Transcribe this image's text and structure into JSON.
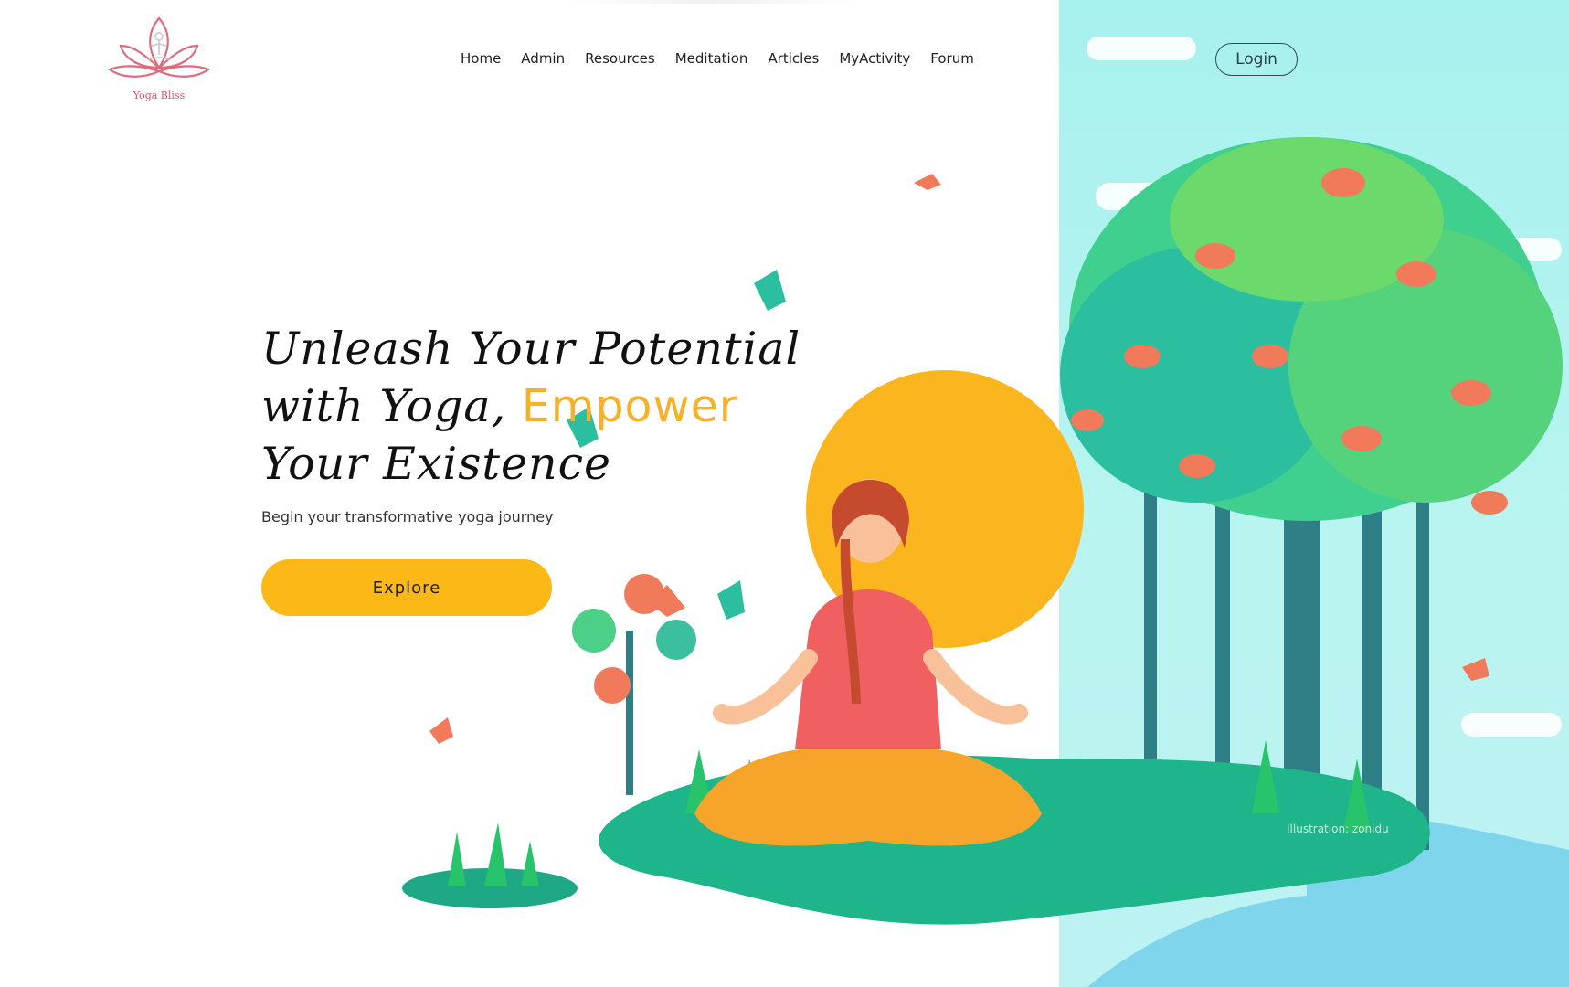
{
  "brand": {
    "name": "Yoga Bliss",
    "logo_icon": "lotus-meditation-icon",
    "color": "#d8556a"
  },
  "nav": {
    "items": [
      {
        "label": "Home"
      },
      {
        "label": "Admin"
      },
      {
        "label": "Resources"
      },
      {
        "label": "Meditation"
      },
      {
        "label": "Articles"
      },
      {
        "label": "MyActivity"
      },
      {
        "label": "Forum"
      }
    ],
    "login_label": "Login"
  },
  "hero": {
    "title_part1": "Unleash Your Potential with Yoga, ",
    "title_accent": "Empower",
    "title_part2": " Your Existence",
    "subtitle": "Begin your transformative yoga journey",
    "cta_label": "Explore",
    "accent_color": "#f6b12a",
    "cta_color": "#fbb817"
  },
  "illustration": {
    "name": "meditating-woman-under-tree-illustration",
    "credit": "Illustration: zonidu"
  }
}
